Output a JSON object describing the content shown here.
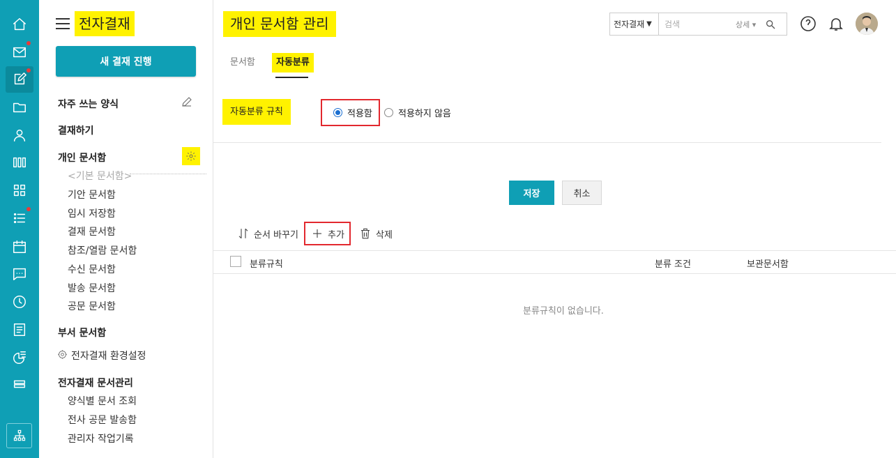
{
  "app": {
    "title": "전자결재",
    "new_button": "새 결재 진행"
  },
  "sidebar": {
    "favorites": "자주 쓰는 양식",
    "approve": "결재하기",
    "personal_box": "개인 문서함",
    "personal_items": [
      "<기본 문서함>",
      "기안 문서함",
      "임시 저장함",
      "결재 문서함",
      "참조/열람 문서함",
      "수신 문서함",
      "발송 문서함",
      "공문 문서함"
    ],
    "dept_box": "부서 문서함",
    "settings": "전자결재 환경설정",
    "manage": "전자결재 문서관리",
    "manage_items": [
      "양식별 문서 조회",
      "전사 공문 발송함",
      "관리자 작업기록"
    ]
  },
  "header": {
    "page_title": "개인 문서함 관리",
    "search_scope": "전자결재",
    "search_placeholder": "검색",
    "search_detail": "상세 ▾"
  },
  "tabs": [
    {
      "label": "문서함",
      "active": false
    },
    {
      "label": "자동분류",
      "active": true
    }
  ],
  "rule": {
    "label": "자동분류 규칙",
    "options": [
      {
        "label": "적용함",
        "checked": true
      },
      {
        "label": "적용하지 않음",
        "checked": false
      }
    ]
  },
  "buttons": {
    "save": "저장",
    "cancel": "취소"
  },
  "toolbar": {
    "reorder": "순서 바꾸기",
    "add": "추가",
    "delete": "삭제"
  },
  "table": {
    "columns": [
      "분류규칙",
      "분류 조건",
      "보관문서함"
    ],
    "empty": "분류규칙이 없습니다."
  },
  "colors": {
    "brand": "#0f9fb5",
    "highlight": "#fff200",
    "annotation": "#e2282e"
  }
}
